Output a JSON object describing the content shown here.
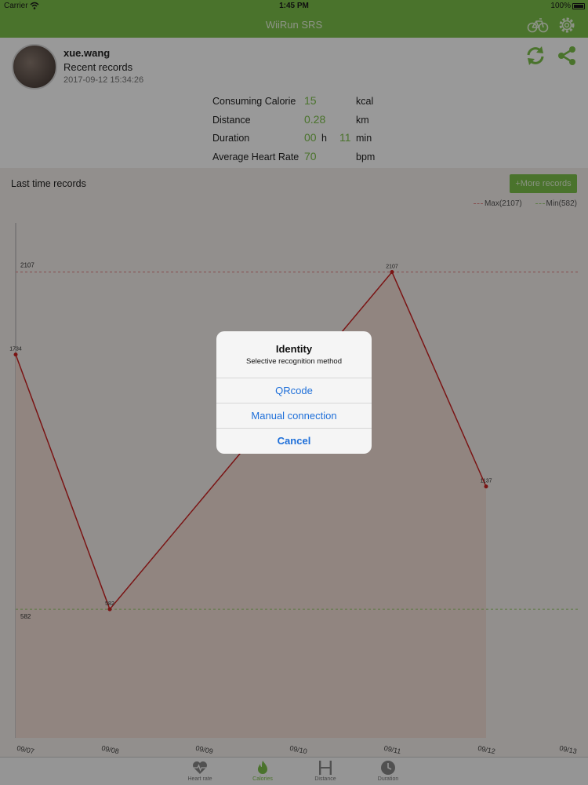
{
  "status": {
    "carrier": "Carrier",
    "time": "1:45 PM",
    "battery": "100%"
  },
  "nav": {
    "title": "WiiRun SRS"
  },
  "profile": {
    "username": "xue.wang",
    "subtitle": "Recent records",
    "datetime": "2017-09-12 15:34:26"
  },
  "stats": {
    "calorie": {
      "label": "Consuming Calorie",
      "value": "15",
      "unit": "kcal"
    },
    "distance": {
      "label": "Distance",
      "value": "0.28",
      "unit": "km"
    },
    "duration": {
      "label": "Duration",
      "hours": "00",
      "h_unit": "h",
      "minutes": "11",
      "m_unit": "min"
    },
    "heart": {
      "label": "Average Heart Rate",
      "value": "70",
      "unit": "bpm"
    }
  },
  "records": {
    "title": "Last time records",
    "more_label": "+More records",
    "legend_max": "Max(2107)",
    "legend_min": "Min(582)"
  },
  "chart_data": {
    "type": "line",
    "x": [
      "09/07",
      "09/08",
      "09/09",
      "09/10",
      "09/11",
      "09/12",
      "09/13"
    ],
    "values": [
      1734,
      582,
      null,
      null,
      2107,
      1137,
      null
    ],
    "point_labels": [
      "1734",
      "582",
      "",
      "",
      "2107",
      "1137",
      ""
    ],
    "max_line": 2107,
    "min_line": 582,
    "max_label": "2107",
    "min_label": "582",
    "ylim": [
      0,
      2400
    ],
    "line_color": "#cc2222",
    "fill_color": "#f2ded6",
    "max_color": "#e08080",
    "min_color": "#9acc70"
  },
  "tabs": [
    {
      "label": "Heart rate",
      "icon": "heart-pulse-icon"
    },
    {
      "label": "Calories",
      "icon": "flame-icon"
    },
    {
      "label": "Distance",
      "icon": "distance-icon"
    },
    {
      "label": "Duration",
      "icon": "clock-icon"
    }
  ],
  "dialog": {
    "title": "Identity",
    "message": "Selective recognition method",
    "options": [
      "QRcode",
      "Manual connection"
    ],
    "cancel": "Cancel"
  },
  "colors": {
    "accent": "#7cc04a",
    "link": "#1e6fd9"
  }
}
